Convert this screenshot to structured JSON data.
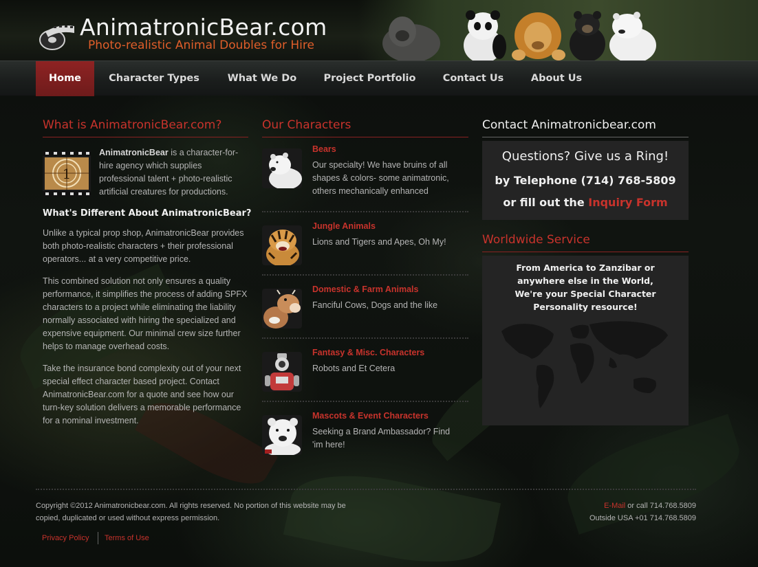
{
  "brand": {
    "title": "AnimatronicBear.com",
    "tagline": "Photo-realistic Animal Doubles for Hire"
  },
  "nav": {
    "items": [
      {
        "label": "Home",
        "active": true
      },
      {
        "label": "Character Types"
      },
      {
        "label": "What We Do"
      },
      {
        "label": "Project Portfolio"
      },
      {
        "label": "Contact Us"
      },
      {
        "label": "About Us"
      }
    ]
  },
  "left": {
    "title": "What is AnimatronicBear.com?",
    "intro_name": "AnimatronicBear",
    "intro_rest": " is a character-for-hire agency which supplies professional talent + photo-realistic artificial creatures for productions.",
    "subheading": "What's Different About AnimatronicBear?",
    "paragraphs": [
      "Unlike a typical prop shop, AnimatronicBear provides both photo-realistic characters + their professional operators... at a very competitive price.",
      "This combined solution not only ensures a quality performance, it simplifies the process of adding SPFX characters to a project while eliminating the liability normally associated with hiring the specialized and expensive equipment. Our minimal crew size further helps to manage overhead costs.",
      "Take the insurance bond complexity out of your next special effect character based project. Contact AnimatronicBear.com for a quote and see how our turn-key solution delivers a memorable performance for a nominal investment."
    ]
  },
  "middle": {
    "title": "Our Characters",
    "characters": [
      {
        "name": "Bears",
        "desc": "Our specialty! We have bruins of all shapes & colors- some animatronic, others mechanically enhanced"
      },
      {
        "name": "Jungle Animals",
        "desc": "Lions and Tigers and Apes, Oh My!"
      },
      {
        "name": "Domestic & Farm Animals",
        "desc": "Fanciful Cows, Dogs and the like"
      },
      {
        "name": "Fantasy & Misc. Characters",
        "desc": "Robots and Et Cetera"
      },
      {
        "name": "Mascots & Event Characters",
        "desc": "Seeking a Brand Ambassador? Find 'im here!"
      }
    ]
  },
  "right": {
    "contact_title": "Contact Animatronicbear.com",
    "ring_line": "Questions?  Give us a Ring!",
    "phone_line": "by Telephone (714) 768-5809",
    "fill_prefix": "or fill out the ",
    "fill_link": "Inquiry Form",
    "ww_title": "Worldwide Service",
    "ww_text": "From America to Zanzibar or anywhere else in the World, We're your Special Character Personality resource!"
  },
  "footer": {
    "copyright": "Copyright ©2012 Animatronicbear.com. All rights reserved. No portion of this website may be copied, duplicated or used without express permission.",
    "privacy": "Privacy Policy",
    "terms": "Terms of Use",
    "email_link": "E-Mail",
    "call_text": " or call 714.768.5809",
    "outside": "Outside USA +01 714.768.5809"
  },
  "colors": {
    "accent_red": "#c8332c",
    "nav_active": "#8e2323",
    "logo_orange": "#e05e2a",
    "panel_bg": "#242424"
  }
}
